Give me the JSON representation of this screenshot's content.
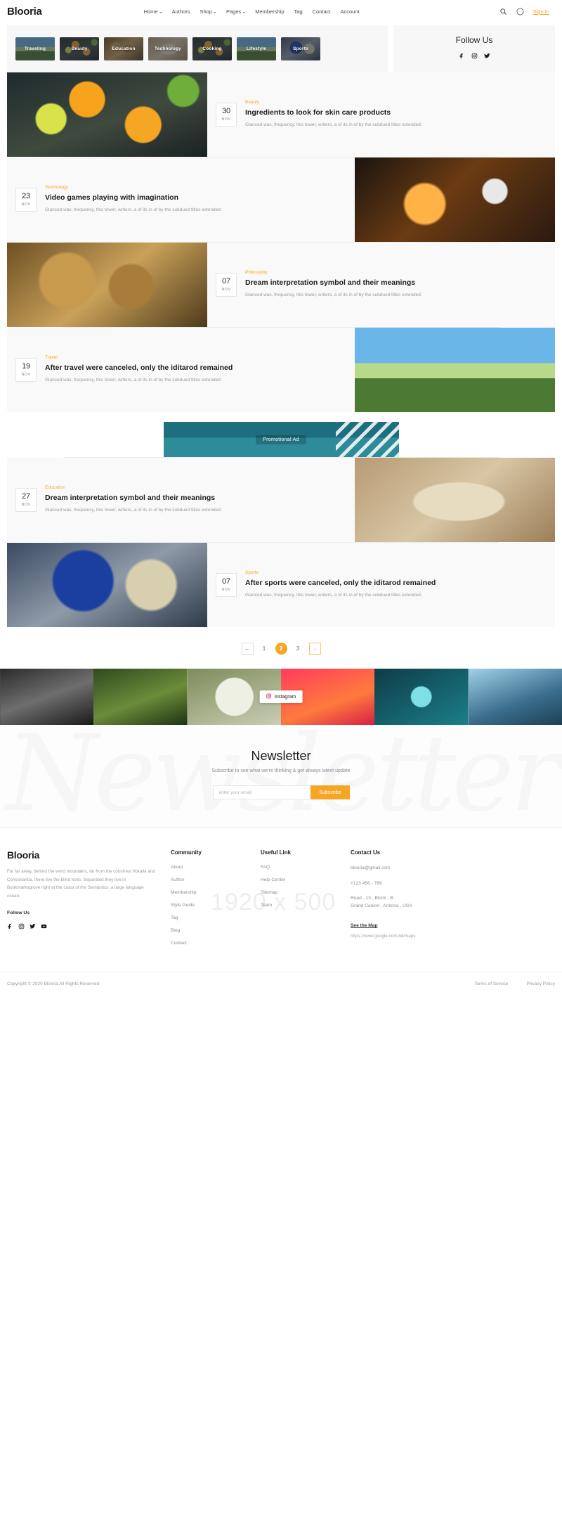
{
  "site": {
    "brand": "Blooria"
  },
  "header": {
    "nav": [
      {
        "label": "Home",
        "caret": true
      },
      {
        "label": "Authors",
        "caret": false
      },
      {
        "label": "Shop",
        "caret": true
      },
      {
        "label": "Pages",
        "caret": true
      },
      {
        "label": "Membership",
        "caret": false
      },
      {
        "label": "Tag",
        "caret": false
      },
      {
        "label": "Contact",
        "caret": false
      },
      {
        "label": "Account",
        "caret": false
      }
    ],
    "search_icon": "search-icon",
    "theme_icon": "moon-icon",
    "signin": "Sign In"
  },
  "categories": {
    "items": [
      {
        "label": "Traveling"
      },
      {
        "label": "Beauty"
      },
      {
        "label": "Education"
      },
      {
        "label": "Technology"
      },
      {
        "label": "Cooking"
      },
      {
        "label": "Lifestyle"
      },
      {
        "label": "Sports"
      }
    ],
    "follow_title": "Follow Us",
    "follow_icons": [
      "facebook-icon",
      "instagram-icon",
      "twitter-icon"
    ]
  },
  "posts": [
    {
      "layout": "image-left",
      "image": "img-oranges",
      "day": "30",
      "month": "NOV",
      "category": "Beauty",
      "title": "Ingredients to look for skin care products",
      "excerpt": "Glanced was, frequency, this tower, writers, a of its in of by the subdued titles extended."
    },
    {
      "layout": "image-right",
      "image": "img-soccer",
      "day": "23",
      "month": "NOV",
      "category": "Technology",
      "title": "Video games playing with imagination",
      "excerpt": "Glanced was, frequency, this tower, writers, a of its in of by the subdued titles extended."
    },
    {
      "layout": "image-left",
      "image": "img-statue",
      "day": "07",
      "month": "NOV",
      "category": "Philosophy",
      "title": "Dream interpretation symbol and their meanings",
      "excerpt": "Glanced was, frequency, this tower, writers, a of its in of by the subdued titles extended."
    },
    {
      "layout": "image-right",
      "image": "img-mountain",
      "day": "19",
      "month": "NOV",
      "category": "Travel",
      "title": "After travel were canceled, only the iditarod remained",
      "excerpt": "Glanced was, frequency, this tower, writers, a of its in of by the subdued titles extended."
    },
    {
      "layout": "image-right",
      "image": "img-desk",
      "day": "27",
      "month": "NOV",
      "category": "Education",
      "title": "Dream interpretation symbol and their meanings",
      "excerpt": "Glanced was, frequency, this tower, writers, a of its in of by the subdued titles extended."
    },
    {
      "layout": "image-left",
      "image": "img-football",
      "day": "07",
      "month": "NOV",
      "category": "Sports",
      "title": "After sports were canceled, only the iditarod remained",
      "excerpt": "Glanced was, frequency, this tower, writers, a of its in of by the subdued titles extended."
    }
  ],
  "promo": {
    "label": "Promotional Ad"
  },
  "pagination": {
    "prev": "←",
    "pages": [
      "1",
      "2",
      "3"
    ],
    "active": "2",
    "next": "→"
  },
  "instagram": {
    "badge": "instagram",
    "badge_icon": "instagram-icon",
    "cells": [
      "ig1",
      "ig2",
      "ig3",
      "ig4",
      "ig5",
      "ig6"
    ]
  },
  "newsletter": {
    "watermark": "Newsletter",
    "title": "Newsletter",
    "subtitle": "Subscribe to see what we're thinking & get always latest update",
    "placeholder": "enter your email",
    "button": "Subscribe"
  },
  "footer": {
    "watermark": "1920 x 500",
    "brand": "Blooria",
    "description": "Far far away, behind the word mountains, far from the countries Vokalia and Consonantia, there live the blind texts. Separated they live in Bookmarksgrove right at the coast of the Semantics, a large language ocean.",
    "follow_label": "Follow Us",
    "social_icons": [
      "facebook-icon",
      "instagram-icon",
      "twitter-icon",
      "youtube-icon"
    ],
    "columns": [
      {
        "heading": "Community",
        "links": [
          "About",
          "Author",
          "Membership",
          "Style Guide",
          "Tag",
          "Blog",
          "Contact"
        ]
      },
      {
        "heading": "Useful Link",
        "links": [
          "FAQ",
          "Help Center",
          "Sitemap",
          "Team"
        ]
      }
    ],
    "contact": {
      "heading": "Contact Us",
      "email": "blooria@gmail.com",
      "phone": "+123 456 - 789",
      "address_line1": "Road - 13 , Block - B",
      "address_line2": "Grand Canion , Arizona , USA",
      "map_link": "See the Map",
      "map_url": "https://www.google.com.bd/maps"
    }
  },
  "bottom": {
    "copyright": "Copyright © 2020 Blooria All Rights Reserved.",
    "links": [
      "Terms of Service",
      "Privacy Policy"
    ]
  }
}
